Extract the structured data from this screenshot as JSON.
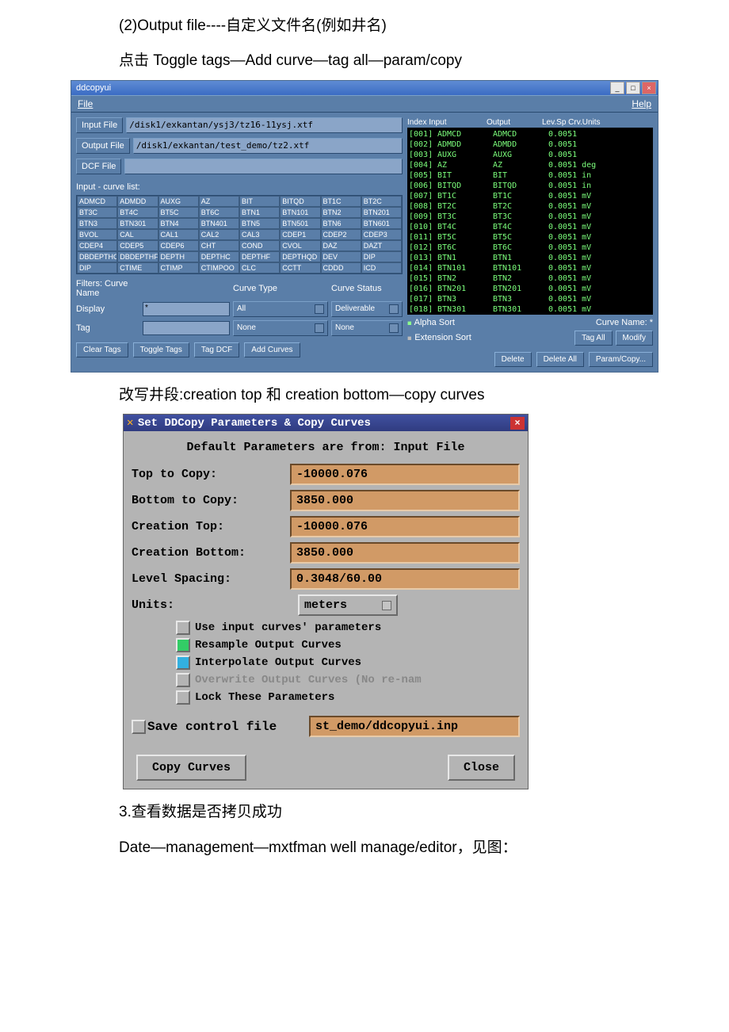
{
  "doc": {
    "line1": "(2)Output file----自定义文件名(例如井名)",
    "line2": "点击 Toggle tags—Add curve—tag all—param/copy",
    "line3": "改写井段:creation top 和 creation bottom—copy curves",
    "line4": "3.查看数据是否拷贝成功",
    "line5": "Date—management—mxtfman well manage/editor，见图："
  },
  "win1": {
    "title": "ddcopyui",
    "menu_file": "File",
    "menu_help": "Help",
    "input_file_lbl": "Input File",
    "input_file": "/disk1/exkantan/ysj3/tz16-11ysj.xtf",
    "output_file_lbl": "Output File",
    "output_file": "/disk1/exkantan/test_demo/tz2.xtf",
    "dcf_file_lbl": "DCF File",
    "dcf_file": "",
    "input_curve_list_lbl": "Input - curve list:",
    "curves_grid": [
      [
        "ADMCD",
        "ADMDD",
        "AUXG",
        "AZ",
        "BIT",
        "BITQD",
        "BT1C",
        "BT2C"
      ],
      [
        "BT3C",
        "BT4C",
        "BT5C",
        "BT6C",
        "BTN1",
        "BTN101",
        "BTN2",
        "BTN201"
      ],
      [
        "BTN3",
        "BTN301",
        "BTN4",
        "BTN401",
        "BTN5",
        "BTN501",
        "BTN6",
        "BTN601"
      ],
      [
        "BVOL",
        "CAL",
        "CAL1",
        "CAL2",
        "CAL3",
        "CDEP1",
        "CDEP2",
        "CDEP3"
      ],
      [
        "CDEP4",
        "CDEP5",
        "CDEP6",
        "CHT",
        "COND",
        "CVOL",
        "DAZ",
        "DAZT"
      ],
      [
        "DBDEPTHC",
        "DBDEPTHF",
        "DEPTH",
        "DEPTHC",
        "DEPTHF",
        "DEPTHQD",
        "DEV",
        "DIP"
      ],
      [
        "DIP",
        "CTIME",
        "CTIMP",
        "CTIMPOO",
        "CLC",
        "CCTT",
        "CDDD",
        "ICD"
      ]
    ],
    "filters_lbl": "Filters: Curve Name",
    "curve_type_lbl": "Curve Type",
    "curve_status_lbl": "Curve Status",
    "display_lbl": "Display",
    "display_val": "*",
    "type_val": "All",
    "status_val": "Deliverable",
    "tag_lbl": "Tag",
    "tag_val": "",
    "type_val2": "None",
    "status_val2": "None",
    "btn_clear": "Clear Tags",
    "btn_toggle": "Toggle Tags",
    "btn_tagdcf": "Tag DCF",
    "btn_addcurves": "Add Curves",
    "r_head_index": "Index Input",
    "r_head_output": "Output",
    "r_head_lev": "Lev.Sp Crv.Units",
    "rows": [
      {
        "idx": "[001]",
        "in": "ADMCD",
        "out": "ADMCD",
        "lev": "0.0051"
      },
      {
        "idx": "[002]",
        "in": "ADMDD",
        "out": "ADMDD",
        "lev": "0.0051"
      },
      {
        "idx": "[003]",
        "in": "AUXG",
        "out": "AUXG",
        "lev": "0.0051"
      },
      {
        "idx": "[004]",
        "in": "AZ",
        "out": "AZ",
        "lev": "0.0051 deg"
      },
      {
        "idx": "[005]",
        "in": "BIT",
        "out": "BIT",
        "lev": "0.0051 in"
      },
      {
        "idx": "[006]",
        "in": "BITQD",
        "out": "BITQD",
        "lev": "0.0051 in"
      },
      {
        "idx": "[007]",
        "in": "BT1C",
        "out": "BT1C",
        "lev": "0.0051 mV"
      },
      {
        "idx": "[008]",
        "in": "BT2C",
        "out": "BT2C",
        "lev": "0.0051 mV"
      },
      {
        "idx": "[009]",
        "in": "BT3C",
        "out": "BT3C",
        "lev": "0.0051 mV"
      },
      {
        "idx": "[010]",
        "in": "BT4C",
        "out": "BT4C",
        "lev": "0.0051 mV"
      },
      {
        "idx": "[011]",
        "in": "BT5C",
        "out": "BT5C",
        "lev": "0.0051 mV"
      },
      {
        "idx": "[012]",
        "in": "BT6C",
        "out": "BT6C",
        "lev": "0.0051 mV"
      },
      {
        "idx": "[013]",
        "in": "BTN1",
        "out": "BTN1",
        "lev": "0.0051 mV"
      },
      {
        "idx": "[014]",
        "in": "BTN101",
        "out": "BTN101",
        "lev": "0.0051 mV"
      },
      {
        "idx": "[015]",
        "in": "BTN2",
        "out": "BTN2",
        "lev": "0.0051 mV"
      },
      {
        "idx": "[016]",
        "in": "BTN201",
        "out": "BTN201",
        "lev": "0.0051 mV"
      },
      {
        "idx": "[017]",
        "in": "BTN3",
        "out": "BTN3",
        "lev": "0.0051 mV"
      },
      {
        "idx": "[018]",
        "in": "BTN301",
        "out": "BTN301",
        "lev": "0.0051 mV"
      }
    ],
    "alpha_sort": "Alpha Sort",
    "ext_sort": "Extension Sort",
    "curve_name_lbl": "Curve Name: *",
    "btn_tagall": "Tag All",
    "btn_modify": "Modify",
    "btn_delete": "Delete",
    "btn_deleteall": "Delete All",
    "btn_paramcopy": "Param/Copy..."
  },
  "win2": {
    "title": "Set DDCopy Parameters & Copy Curves",
    "subhead": "Default Parameters are from: Input  File",
    "top_to_copy_lbl": "Top to Copy:",
    "top_to_copy": "-10000.076",
    "bottom_to_copy_lbl": "Bottom to Copy:",
    "bottom_to_copy": "3850.000",
    "creation_top_lbl": "Creation Top:",
    "creation_top": "-10000.076",
    "creation_bottom_lbl": "Creation Bottom:",
    "creation_bottom": "3850.000",
    "level_spacing_lbl": "Level Spacing:",
    "level_spacing": "0.3048/60.00",
    "units_lbl": "Units:",
    "units": "meters",
    "chk1": "Use input curves' parameters",
    "chk2": "Resample Output Curves",
    "chk3": "Interpolate Output Curves",
    "chk4": "Overwrite Output Curves (No re-nam",
    "chk5": "Lock These Parameters",
    "save_lbl": "Save control file",
    "save_file": "st_demo/ddcopyui.inp",
    "btn_copy": "Copy Curves",
    "btn_close": "Close"
  }
}
